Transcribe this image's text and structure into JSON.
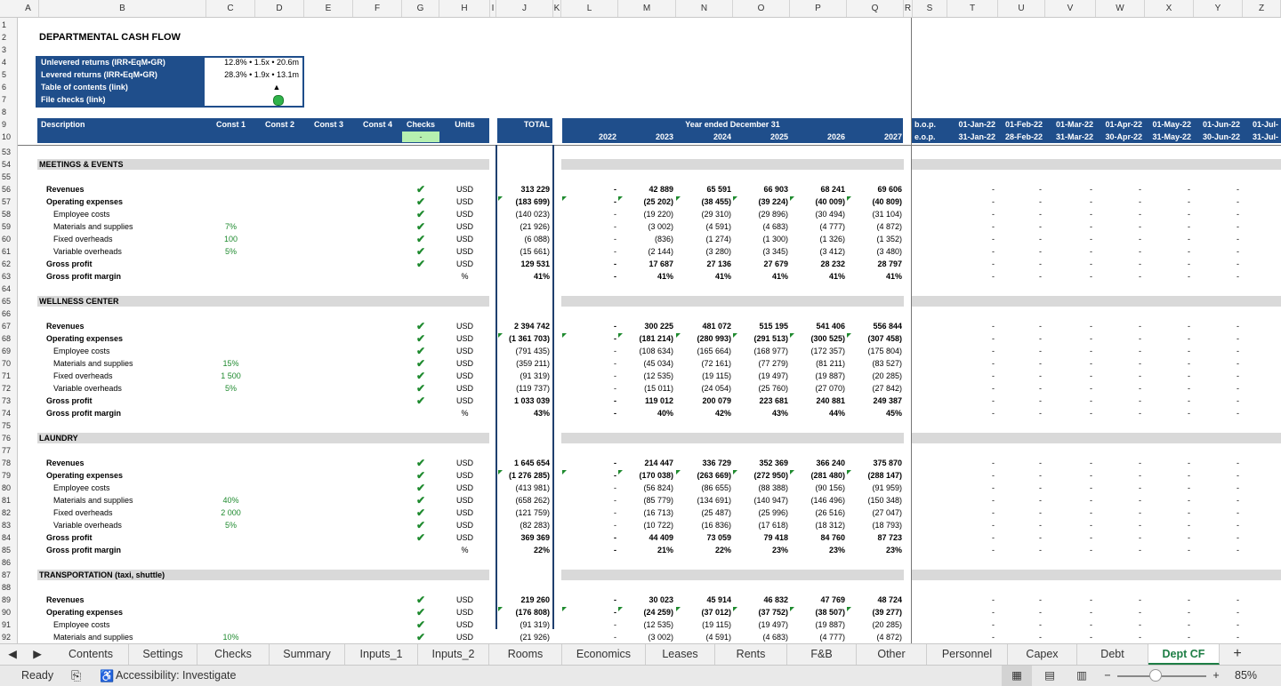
{
  "columns": [
    "A",
    "B",
    "C",
    "D",
    "E",
    "F",
    "G",
    "H",
    "I",
    "J",
    "K",
    "L",
    "M",
    "N",
    "O",
    "P",
    "Q",
    "R",
    "S",
    "T",
    "U",
    "V",
    "W",
    "X",
    "Y",
    "Z"
  ],
  "top_rows": [
    "1",
    "2",
    "3",
    "4",
    "5",
    "6",
    "7",
    "8",
    "9",
    "10"
  ],
  "body_rows": [
    "53",
    "54",
    "55",
    "56",
    "57",
    "58",
    "59",
    "60",
    "61",
    "62",
    "63",
    "64",
    "65",
    "66",
    "67",
    "68",
    "69",
    "70",
    "71",
    "72",
    "73",
    "74",
    "75",
    "76",
    "77",
    "78",
    "79",
    "80",
    "81",
    "82",
    "83",
    "84",
    "85",
    "86",
    "87",
    "88",
    "89",
    "90",
    "91",
    "92"
  ],
  "title": "DEPARTMENTAL CASH FLOW",
  "summary": {
    "unlevered_label": "Unlevered returns (IRR•EqM•GR)",
    "unlevered_value": "12.8% • 1.5x • 20.6m",
    "levered_label": "Levered returns (IRR•EqM•GR)",
    "levered_value": "28.3% • 1.9x • 13.1m",
    "toc_label": "Table of contents (link)",
    "toc_value": "▲",
    "checks_label": "File checks (link)"
  },
  "header": {
    "description": "Description",
    "const1": "Const 1",
    "const2": "Const 2",
    "const3": "Const 3",
    "const4": "Const 4",
    "checks": "Checks",
    "checks_value": "-",
    "units": "Units",
    "total": "TOTAL",
    "year_ended": "Year ended December 31",
    "years": [
      "2022",
      "2023",
      "2024",
      "2025",
      "2026",
      "2027"
    ],
    "bop": "b.o.p.",
    "eop": "e.o.p.",
    "month_start": [
      "01-Jan-22",
      "01-Feb-22",
      "01-Mar-22",
      "01-Apr-22",
      "01-May-22",
      "01-Jun-22",
      "01-Jul-"
    ],
    "month_end": [
      "31-Jan-22",
      "28-Feb-22",
      "31-Mar-22",
      "30-Apr-22",
      "31-May-22",
      "30-Jun-22",
      "31-Jul-"
    ]
  },
  "sections": [
    {
      "name": "MEETINGS & EVENTS",
      "rows": [
        {
          "label": "Revenues",
          "bold": true,
          "indent": 0,
          "const": "",
          "check": true,
          "unit": "USD",
          "total": "313 229",
          "years": [
            "-",
            "42 889",
            "65 591",
            "66 903",
            "68 241",
            "69 606"
          ]
        },
        {
          "label": "Operating expenses",
          "bold": true,
          "indent": 0,
          "const": "",
          "check": true,
          "unit": "USD",
          "total": "(183 699)",
          "years": [
            "-",
            "(25 202)",
            "(38 455)",
            "(39 224)",
            "(40 009)",
            "(40 809)"
          ]
        },
        {
          "label": "Employee costs",
          "bold": false,
          "indent": 1,
          "const": "",
          "check": true,
          "unit": "USD",
          "total": "(140 023)",
          "years": [
            "-",
            "(19 220)",
            "(29 310)",
            "(29 896)",
            "(30 494)",
            "(31 104)"
          ]
        },
        {
          "label": "Materials and supplies",
          "bold": false,
          "indent": 1,
          "const": "7%",
          "check": true,
          "unit": "USD",
          "total": "(21 926)",
          "years": [
            "-",
            "(3 002)",
            "(4 591)",
            "(4 683)",
            "(4 777)",
            "(4 872)"
          ]
        },
        {
          "label": "Fixed overheads",
          "bold": false,
          "indent": 1,
          "const": "100",
          "check": true,
          "unit": "USD",
          "total": "(6 088)",
          "years": [
            "-",
            "(836)",
            "(1 274)",
            "(1 300)",
            "(1 326)",
            "(1 352)"
          ]
        },
        {
          "label": "Variable overheads",
          "bold": false,
          "indent": 1,
          "const": "5%",
          "check": true,
          "unit": "USD",
          "total": "(15 661)",
          "years": [
            "-",
            "(2 144)",
            "(3 280)",
            "(3 345)",
            "(3 412)",
            "(3 480)"
          ]
        },
        {
          "label": "Gross profit",
          "bold": true,
          "indent": 0,
          "const": "",
          "check": true,
          "unit": "USD",
          "total": "129 531",
          "years": [
            "-",
            "17 687",
            "27 136",
            "27 679",
            "28 232",
            "28 797"
          ]
        },
        {
          "label": "Gross profit margin",
          "bold": true,
          "indent": 0,
          "const": "",
          "check": false,
          "unit": "%",
          "total": "41%",
          "years": [
            "-",
            "41%",
            "41%",
            "41%",
            "41%",
            "41%"
          ]
        }
      ]
    },
    {
      "name": "WELLNESS CENTER",
      "rows": [
        {
          "label": "Revenues",
          "bold": true,
          "indent": 0,
          "const": "",
          "check": true,
          "unit": "USD",
          "total": "2 394 742",
          "years": [
            "-",
            "300 225",
            "481 072",
            "515 195",
            "541 406",
            "556 844"
          ]
        },
        {
          "label": "Operating expenses",
          "bold": true,
          "indent": 0,
          "const": "",
          "check": true,
          "unit": "USD",
          "total": "(1 361 703)",
          "years": [
            "-",
            "(181 214)",
            "(280 993)",
            "(291 513)",
            "(300 525)",
            "(307 458)"
          ]
        },
        {
          "label": "Employee costs",
          "bold": false,
          "indent": 1,
          "const": "",
          "check": true,
          "unit": "USD",
          "total": "(791 435)",
          "years": [
            "-",
            "(108 634)",
            "(165 664)",
            "(168 977)",
            "(172 357)",
            "(175 804)"
          ]
        },
        {
          "label": "Materials and supplies",
          "bold": false,
          "indent": 1,
          "const": "15%",
          "check": true,
          "unit": "USD",
          "total": "(359 211)",
          "years": [
            "-",
            "(45 034)",
            "(72 161)",
            "(77 279)",
            "(81 211)",
            "(83 527)"
          ]
        },
        {
          "label": "Fixed overheads",
          "bold": false,
          "indent": 1,
          "const": "1 500",
          "check": true,
          "unit": "USD",
          "total": "(91 319)",
          "years": [
            "-",
            "(12 535)",
            "(19 115)",
            "(19 497)",
            "(19 887)",
            "(20 285)"
          ]
        },
        {
          "label": "Variable overheads",
          "bold": false,
          "indent": 1,
          "const": "5%",
          "check": true,
          "unit": "USD",
          "total": "(119 737)",
          "years": [
            "-",
            "(15 011)",
            "(24 054)",
            "(25 760)",
            "(27 070)",
            "(27 842)"
          ]
        },
        {
          "label": "Gross profit",
          "bold": true,
          "indent": 0,
          "const": "",
          "check": true,
          "unit": "USD",
          "total": "1 033 039",
          "years": [
            "-",
            "119 012",
            "200 079",
            "223 681",
            "240 881",
            "249 387"
          ]
        },
        {
          "label": "Gross profit margin",
          "bold": true,
          "indent": 0,
          "const": "",
          "check": false,
          "unit": "%",
          "total": "43%",
          "years": [
            "-",
            "40%",
            "42%",
            "43%",
            "44%",
            "45%"
          ]
        }
      ]
    },
    {
      "name": "LAUNDRY",
      "rows": [
        {
          "label": "Revenues",
          "bold": true,
          "indent": 0,
          "const": "",
          "check": true,
          "unit": "USD",
          "total": "1 645 654",
          "years": [
            "-",
            "214 447",
            "336 729",
            "352 369",
            "366 240",
            "375 870"
          ]
        },
        {
          "label": "Operating expenses",
          "bold": true,
          "indent": 0,
          "const": "",
          "check": true,
          "unit": "USD",
          "total": "(1 276 285)",
          "years": [
            "-",
            "(170 038)",
            "(263 669)",
            "(272 950)",
            "(281 480)",
            "(288 147)"
          ]
        },
        {
          "label": "Employee costs",
          "bold": false,
          "indent": 1,
          "const": "",
          "check": true,
          "unit": "USD",
          "total": "(413 981)",
          "years": [
            "-",
            "(56 824)",
            "(86 655)",
            "(88 388)",
            "(90 156)",
            "(91 959)"
          ]
        },
        {
          "label": "Materials and supplies",
          "bold": false,
          "indent": 1,
          "const": "40%",
          "check": true,
          "unit": "USD",
          "total": "(658 262)",
          "years": [
            "-",
            "(85 779)",
            "(134 691)",
            "(140 947)",
            "(146 496)",
            "(150 348)"
          ]
        },
        {
          "label": "Fixed overheads",
          "bold": false,
          "indent": 1,
          "const": "2 000",
          "check": true,
          "unit": "USD",
          "total": "(121 759)",
          "years": [
            "-",
            "(16 713)",
            "(25 487)",
            "(25 996)",
            "(26 516)",
            "(27 047)"
          ]
        },
        {
          "label": "Variable overheads",
          "bold": false,
          "indent": 1,
          "const": "5%",
          "check": true,
          "unit": "USD",
          "total": "(82 283)",
          "years": [
            "-",
            "(10 722)",
            "(16 836)",
            "(17 618)",
            "(18 312)",
            "(18 793)"
          ]
        },
        {
          "label": "Gross profit",
          "bold": true,
          "indent": 0,
          "const": "",
          "check": true,
          "unit": "USD",
          "total": "369 369",
          "years": [
            "-",
            "44 409",
            "73 059",
            "79 418",
            "84 760",
            "87 723"
          ]
        },
        {
          "label": "Gross profit margin",
          "bold": true,
          "indent": 0,
          "const": "",
          "check": false,
          "unit": "%",
          "total": "22%",
          "years": [
            "-",
            "21%",
            "22%",
            "23%",
            "23%",
            "23%"
          ]
        }
      ]
    },
    {
      "name": "TRANSPORTATION (taxi, shuttle)",
      "rows": [
        {
          "label": "Revenues",
          "bold": true,
          "indent": 0,
          "const": "",
          "check": true,
          "unit": "USD",
          "total": "219 260",
          "years": [
            "-",
            "30 023",
            "45 914",
            "46 832",
            "47 769",
            "48 724"
          ]
        },
        {
          "label": "Operating expenses",
          "bold": true,
          "indent": 0,
          "const": "",
          "check": true,
          "unit": "USD",
          "total": "(176 808)",
          "years": [
            "-",
            "(24 259)",
            "(37 012)",
            "(37 752)",
            "(38 507)",
            "(39 277)"
          ]
        },
        {
          "label": "Employee costs",
          "bold": false,
          "indent": 1,
          "const": "",
          "check": true,
          "unit": "USD",
          "total": "(91 319)",
          "years": [
            "-",
            "(12 535)",
            "(19 115)",
            "(19 497)",
            "(19 887)",
            "(20 285)"
          ]
        },
        {
          "label": "Materials and supplies",
          "bold": false,
          "indent": 1,
          "const": "10%",
          "check": true,
          "unit": "USD",
          "total": "(21 926)",
          "years": [
            "-",
            "(3 002)",
            "(4 591)",
            "(4 683)",
            "(4 777)",
            "(4 872)"
          ]
        }
      ]
    }
  ],
  "monthly_placeholder": "-",
  "tabs": [
    "Contents",
    "Settings",
    "Checks",
    "Summary",
    "Inputs_1",
    "Inputs_2",
    "Rooms",
    "Economics",
    "Leases",
    "Rents",
    "F&B",
    "Other",
    "Personnel",
    "Capex",
    "Debt",
    "Dept CF"
  ],
  "active_tab": "Dept CF",
  "add_tab": "+",
  "status": {
    "ready": "Ready",
    "accessibility": "Accessibility: Investigate",
    "zoom": "85%",
    "zoom_minus": "−",
    "zoom_plus": "+"
  },
  "colors": {
    "navy": "#1f4e8b",
    "green": "#1e8a2e",
    "band": "#d9d9d9",
    "active_tab": "#1e7e45"
  }
}
